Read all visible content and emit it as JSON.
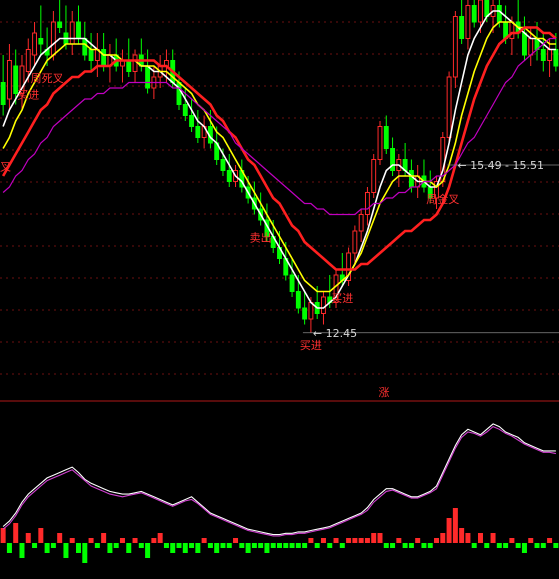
{
  "colors": {
    "background": "#000000",
    "grid": "#6b1010",
    "separator": "#b01818",
    "up": "#ff2a2a",
    "up_body": "#000000",
    "down": "#00ff00",
    "flat": "#ffffff",
    "hollow_up": "#00ffff",
    "ma_white": "#ffffff",
    "ma_yellow": "#ffff00",
    "ma_red": "#ff2020",
    "ma_purple": "#c000c0",
    "osc_white": "#ffffff",
    "osc_purple": "#d040d0",
    "annotation": "#ff3030",
    "price_label": "#d8d8d8"
  },
  "chart_data": [
    {
      "type": "candlestick",
      "title": "",
      "y_range": [
        11.5,
        18.5
      ],
      "grid": true,
      "annotations": [
        {
          "text": "买进",
          "x_index": 4
        },
        {
          "text": "周死叉",
          "x_index": 7
        },
        {
          "text": "卖出",
          "x_index": 41
        },
        {
          "text": "买进",
          "x_index": 49
        },
        {
          "text": "买进",
          "x_index": 54
        },
        {
          "text": "周金叉",
          "x_index": 70
        }
      ],
      "edge_label": "叉",
      "price_labels": [
        {
          "text": "12.45",
          "x_index": 49,
          "value": 12.45
        },
        {
          "text": "15.49 - 15.51",
          "x_index": 72,
          "value": 15.5
        }
      ],
      "candles": [
        [
          17.0,
          17.5,
          16.4,
          16.6
        ],
        [
          16.7,
          17.7,
          16.5,
          17.4
        ],
        [
          17.3,
          17.6,
          16.6,
          16.8
        ],
        [
          16.8,
          17.5,
          16.5,
          17.3
        ],
        [
          17.2,
          17.8,
          17.0,
          17.6
        ],
        [
          17.5,
          18.1,
          17.3,
          17.9
        ],
        [
          17.8,
          18.4,
          17.5,
          17.7
        ],
        [
          17.6,
          18.0,
          17.3,
          17.5
        ],
        [
          17.5,
          18.3,
          17.4,
          18.1
        ],
        [
          18.1,
          18.6,
          17.9,
          18.0
        ],
        [
          17.9,
          18.4,
          17.6,
          17.7
        ],
        [
          17.7,
          18.3,
          17.5,
          18.1
        ],
        [
          18.1,
          18.4,
          17.7,
          17.8
        ],
        [
          17.8,
          18.1,
          17.4,
          17.5
        ],
        [
          17.6,
          17.9,
          17.2,
          17.4
        ],
        [
          17.4,
          17.9,
          17.1,
          17.6
        ],
        [
          17.6,
          17.9,
          17.2,
          17.3
        ],
        [
          17.3,
          17.7,
          17.0,
          17.5
        ],
        [
          17.5,
          17.8,
          17.2,
          17.3
        ],
        [
          17.3,
          17.6,
          17.0,
          17.4
        ],
        [
          17.4,
          17.8,
          17.1,
          17.2
        ],
        [
          17.2,
          17.6,
          17.0,
          17.5
        ],
        [
          17.5,
          17.8,
          17.2,
          17.3
        ],
        [
          17.3,
          17.6,
          16.8,
          16.9
        ],
        [
          16.9,
          17.3,
          16.7,
          17.1
        ],
        [
          17.1,
          17.5,
          16.9,
          17.3
        ],
        [
          17.3,
          17.6,
          17.0,
          17.4
        ],
        [
          17.4,
          17.6,
          16.9,
          17.0
        ],
        [
          17.0,
          17.2,
          16.5,
          16.6
        ],
        [
          16.6,
          16.9,
          16.3,
          16.4
        ],
        [
          16.4,
          16.7,
          16.1,
          16.2
        ],
        [
          16.2,
          16.5,
          15.9,
          16.0
        ],
        [
          16.0,
          16.4,
          15.8,
          16.2
        ],
        [
          16.2,
          16.5,
          15.8,
          15.9
        ],
        [
          15.9,
          16.2,
          15.5,
          15.6
        ],
        [
          15.6,
          15.8,
          15.3,
          15.4
        ],
        [
          15.4,
          15.7,
          15.1,
          15.2
        ],
        [
          15.2,
          15.5,
          15.1,
          15.4
        ],
        [
          15.4,
          15.6,
          15.0,
          15.1
        ],
        [
          15.1,
          15.3,
          14.8,
          14.9
        ],
        [
          14.9,
          15.2,
          14.6,
          14.7
        ],
        [
          14.7,
          15.0,
          14.4,
          14.5
        ],
        [
          14.5,
          14.8,
          14.1,
          14.2
        ],
        [
          14.2,
          14.5,
          13.9,
          14.0
        ],
        [
          14.0,
          14.3,
          13.7,
          13.8
        ],
        [
          13.8,
          14.1,
          13.4,
          13.5
        ],
        [
          13.5,
          13.8,
          13.1,
          13.2
        ],
        [
          13.2,
          13.5,
          12.8,
          12.9
        ],
        [
          12.9,
          13.2,
          12.6,
          12.7
        ],
        [
          12.7,
          13.1,
          12.45,
          13.0
        ],
        [
          13.0,
          13.3,
          12.7,
          12.8
        ],
        [
          12.8,
          13.2,
          12.6,
          13.1
        ],
        [
          13.1,
          13.5,
          12.9,
          13.0
        ],
        [
          13.0,
          13.6,
          12.9,
          13.5
        ],
        [
          13.5,
          13.9,
          13.3,
          13.4
        ],
        [
          13.4,
          14.0,
          13.3,
          13.9
        ],
        [
          13.9,
          14.4,
          13.7,
          14.3
        ],
        [
          14.3,
          14.7,
          14.1,
          14.6
        ],
        [
          14.6,
          15.1,
          14.4,
          15.0
        ],
        [
          15.0,
          15.7,
          14.9,
          15.6
        ],
        [
          15.6,
          16.3,
          15.5,
          16.2
        ],
        [
          16.2,
          16.4,
          15.7,
          15.8
        ],
        [
          15.8,
          16.0,
          15.3,
          15.4
        ],
        [
          15.4,
          15.7,
          15.1,
          15.6
        ],
        [
          15.6,
          15.9,
          15.3,
          15.4
        ],
        [
          15.4,
          15.6,
          15.0,
          15.1
        ],
        [
          15.1,
          15.5,
          14.9,
          15.3
        ],
        [
          15.3,
          15.6,
          15.0,
          15.1
        ],
        [
          15.1,
          15.4,
          14.8,
          14.9
        ],
        [
          14.9,
          15.3,
          14.7,
          15.2
        ],
        [
          15.2,
          16.1,
          15.1,
          16.0
        ],
        [
          16.0,
          17.2,
          15.9,
          17.1
        ],
        [
          17.1,
          18.3,
          16.9,
          18.2
        ],
        [
          18.2,
          18.6,
          17.7,
          17.8
        ],
        [
          17.8,
          18.5,
          17.6,
          18.4
        ],
        [
          18.4,
          18.6,
          18.0,
          18.1
        ],
        [
          18.1,
          18.6,
          17.9,
          18.5
        ],
        [
          18.5,
          18.6,
          18.1,
          18.2
        ],
        [
          18.2,
          18.6,
          17.9,
          18.4
        ],
        [
          18.4,
          18.6,
          18.0,
          18.1
        ],
        [
          18.1,
          18.4,
          17.7,
          17.8
        ],
        [
          17.8,
          18.2,
          17.5,
          18.1
        ],
        [
          18.1,
          18.5,
          17.8,
          17.9
        ],
        [
          17.9,
          18.2,
          17.4,
          17.5
        ],
        [
          17.5,
          18.0,
          17.3,
          17.8
        ],
        [
          17.8,
          18.1,
          17.4,
          17.6
        ],
        [
          17.6,
          17.9,
          17.2,
          17.4
        ],
        [
          17.4,
          17.8,
          17.1,
          17.6
        ],
        [
          17.6,
          17.9,
          17.2,
          17.3
        ]
      ],
      "moving_averages": [
        {
          "color_key": "ma_white",
          "values": [
            16.2,
            16.5,
            16.7,
            16.9,
            17.1,
            17.3,
            17.5,
            17.6,
            17.7,
            17.8,
            17.8,
            17.8,
            17.8,
            17.8,
            17.7,
            17.6,
            17.5,
            17.5,
            17.4,
            17.4,
            17.4,
            17.4,
            17.3,
            17.3,
            17.2,
            17.2,
            17.1,
            17.0,
            16.9,
            16.7,
            16.5,
            16.3,
            16.2,
            16.0,
            15.9,
            15.7,
            15.5,
            15.3,
            15.2,
            15.0,
            14.8,
            14.6,
            14.4,
            14.2,
            14.0,
            13.8,
            13.6,
            13.4,
            13.2,
            13.0,
            12.9,
            12.9,
            13.0,
            13.1,
            13.3,
            13.5,
            13.7,
            14.0,
            14.3,
            14.7,
            15.1,
            15.4,
            15.5,
            15.5,
            15.4,
            15.3,
            15.2,
            15.2,
            15.1,
            15.1,
            15.4,
            15.9,
            16.5,
            17.0,
            17.5,
            17.8,
            18.0,
            18.2,
            18.3,
            18.3,
            18.2,
            18.1,
            18.0,
            17.9,
            17.8,
            17.8,
            17.7,
            17.6,
            17.6
          ]
        },
        {
          "color_key": "ma_yellow",
          "values": [
            15.8,
            16.0,
            16.3,
            16.5,
            16.8,
            17.0,
            17.2,
            17.4,
            17.5,
            17.6,
            17.7,
            17.7,
            17.7,
            17.7,
            17.6,
            17.6,
            17.5,
            17.5,
            17.5,
            17.4,
            17.4,
            17.4,
            17.3,
            17.3,
            17.3,
            17.2,
            17.2,
            17.1,
            17.0,
            16.9,
            16.8,
            16.6,
            16.5,
            16.3,
            16.1,
            16.0,
            15.8,
            15.6,
            15.4,
            15.2,
            15.0,
            14.8,
            14.6,
            14.4,
            14.2,
            14.0,
            13.8,
            13.6,
            13.4,
            13.3,
            13.2,
            13.2,
            13.2,
            13.3,
            13.4,
            13.5,
            13.7,
            13.9,
            14.2,
            14.5,
            14.8,
            15.0,
            15.2,
            15.3,
            15.3,
            15.3,
            15.3,
            15.2,
            15.2,
            15.1,
            15.2,
            15.5,
            15.9,
            16.4,
            16.8,
            17.2,
            17.5,
            17.8,
            18.0,
            18.1,
            18.1,
            18.1,
            18.0,
            18.0,
            17.9,
            17.8,
            17.8,
            17.7,
            17.7
          ]
        },
        {
          "color_key": "ma_red",
          "values": [
            15.3,
            15.5,
            15.7,
            15.9,
            16.1,
            16.3,
            16.5,
            16.6,
            16.8,
            16.9,
            17.0,
            17.1,
            17.1,
            17.2,
            17.2,
            17.3,
            17.3,
            17.3,
            17.4,
            17.4,
            17.4,
            17.4,
            17.4,
            17.4,
            17.4,
            17.3,
            17.3,
            17.2,
            17.1,
            17.0,
            16.9,
            16.8,
            16.7,
            16.6,
            16.4,
            16.3,
            16.1,
            16.0,
            15.8,
            15.6,
            15.5,
            15.3,
            15.1,
            14.9,
            14.8,
            14.6,
            14.4,
            14.3,
            14.1,
            14.0,
            13.9,
            13.8,
            13.7,
            13.6,
            13.6,
            13.6,
            13.6,
            13.7,
            13.7,
            13.8,
            13.9,
            14.0,
            14.1,
            14.2,
            14.3,
            14.3,
            14.4,
            14.5,
            14.5,
            14.6,
            14.8,
            15.1,
            15.5,
            15.9,
            16.3,
            16.7,
            17.0,
            17.3,
            17.5,
            17.7,
            17.8,
            17.9,
            17.9,
            18.0,
            18.0,
            18.0,
            17.9,
            17.9,
            17.8
          ]
        },
        {
          "color_key": "ma_purple",
          "values": [
            15.0,
            15.1,
            15.3,
            15.4,
            15.6,
            15.7,
            15.9,
            16.0,
            16.2,
            16.3,
            16.4,
            16.5,
            16.6,
            16.7,
            16.7,
            16.8,
            16.8,
            16.9,
            16.9,
            16.9,
            17.0,
            17.0,
            17.0,
            17.0,
            17.0,
            17.0,
            17.0,
            16.9,
            16.9,
            16.8,
            16.7,
            16.6,
            16.5,
            16.4,
            16.3,
            16.2,
            16.1,
            15.9,
            15.8,
            15.7,
            15.6,
            15.5,
            15.4,
            15.3,
            15.2,
            15.1,
            15.0,
            14.9,
            14.8,
            14.8,
            14.7,
            14.7,
            14.6,
            14.6,
            14.6,
            14.6,
            14.6,
            14.7,
            14.7,
            14.8,
            14.8,
            14.9,
            14.9,
            15.0,
            15.0,
            15.1,
            15.1,
            15.2,
            15.2,
            15.3,
            15.3,
            15.4,
            15.5,
            15.7,
            15.9,
            16.0,
            16.2,
            16.4,
            16.6,
            16.8,
            17.0,
            17.1,
            17.3,
            17.4,
            17.5,
            17.6,
            17.7,
            17.8,
            17.8
          ]
        }
      ]
    },
    {
      "type": "line",
      "title": "",
      "label": "涨",
      "grid": false,
      "series": [
        {
          "color_key": "osc_white",
          "values": [
            10,
            14,
            20,
            28,
            34,
            38,
            42,
            46,
            48,
            50,
            52,
            54,
            50,
            45,
            42,
            40,
            38,
            36,
            35,
            34,
            34,
            35,
            36,
            34,
            32,
            30,
            28,
            26,
            28,
            30,
            32,
            28,
            24,
            20,
            18,
            16,
            14,
            12,
            10,
            8,
            7,
            6,
            5,
            4,
            4,
            5,
            5,
            6,
            6,
            7,
            8,
            9,
            10,
            12,
            14,
            16,
            18,
            20,
            24,
            30,
            34,
            38,
            38,
            36,
            34,
            32,
            32,
            34,
            36,
            40,
            50,
            60,
            70,
            78,
            82,
            80,
            78,
            82,
            86,
            84,
            80,
            78,
            76,
            72,
            70,
            68,
            66,
            66,
            66
          ]
        },
        {
          "color_key": "osc_purple",
          "values": [
            8,
            12,
            18,
            26,
            32,
            36,
            40,
            44,
            46,
            48,
            50,
            52,
            48,
            44,
            40,
            38,
            36,
            34,
            33,
            32,
            33,
            34,
            35,
            33,
            31,
            29,
            27,
            25,
            27,
            29,
            30,
            27,
            23,
            19,
            17,
            15,
            13,
            11,
            9,
            7,
            6,
            5,
            4,
            3,
            3,
            4,
            4,
            5,
            5,
            6,
            7,
            8,
            9,
            11,
            13,
            15,
            17,
            19,
            22,
            28,
            32,
            36,
            37,
            35,
            33,
            31,
            31,
            33,
            35,
            38,
            48,
            58,
            68,
            76,
            80,
            79,
            77,
            80,
            84,
            82,
            79,
            77,
            74,
            71,
            69,
            67,
            65,
            65,
            64
          ]
        }
      ],
      "histogram": [
        3,
        -2,
        4,
        -3,
        2,
        -1,
        3,
        -2,
        -1,
        2,
        -3,
        1,
        -2,
        -4,
        1,
        -1,
        2,
        -2,
        -1,
        1,
        -2,
        1,
        -1,
        -3,
        1,
        2,
        -1,
        -2,
        -1,
        -2,
        -1,
        -2,
        1,
        -1,
        -2,
        -1,
        -1,
        1,
        -1,
        -2,
        -1,
        -1,
        -2,
        -1,
        -1,
        -1,
        -1,
        -1,
        -1,
        1,
        -1,
        1,
        -1,
        1,
        -1,
        1,
        1,
        1,
        1,
        2,
        2,
        -1,
        -1,
        1,
        -1,
        -1,
        1,
        -1,
        -1,
        1,
        2,
        5,
        7,
        3,
        2,
        -1,
        2,
        -1,
        2,
        -1,
        -1,
        1,
        -1,
        -2,
        1,
        -1,
        -1,
        1,
        -1
      ]
    }
  ]
}
